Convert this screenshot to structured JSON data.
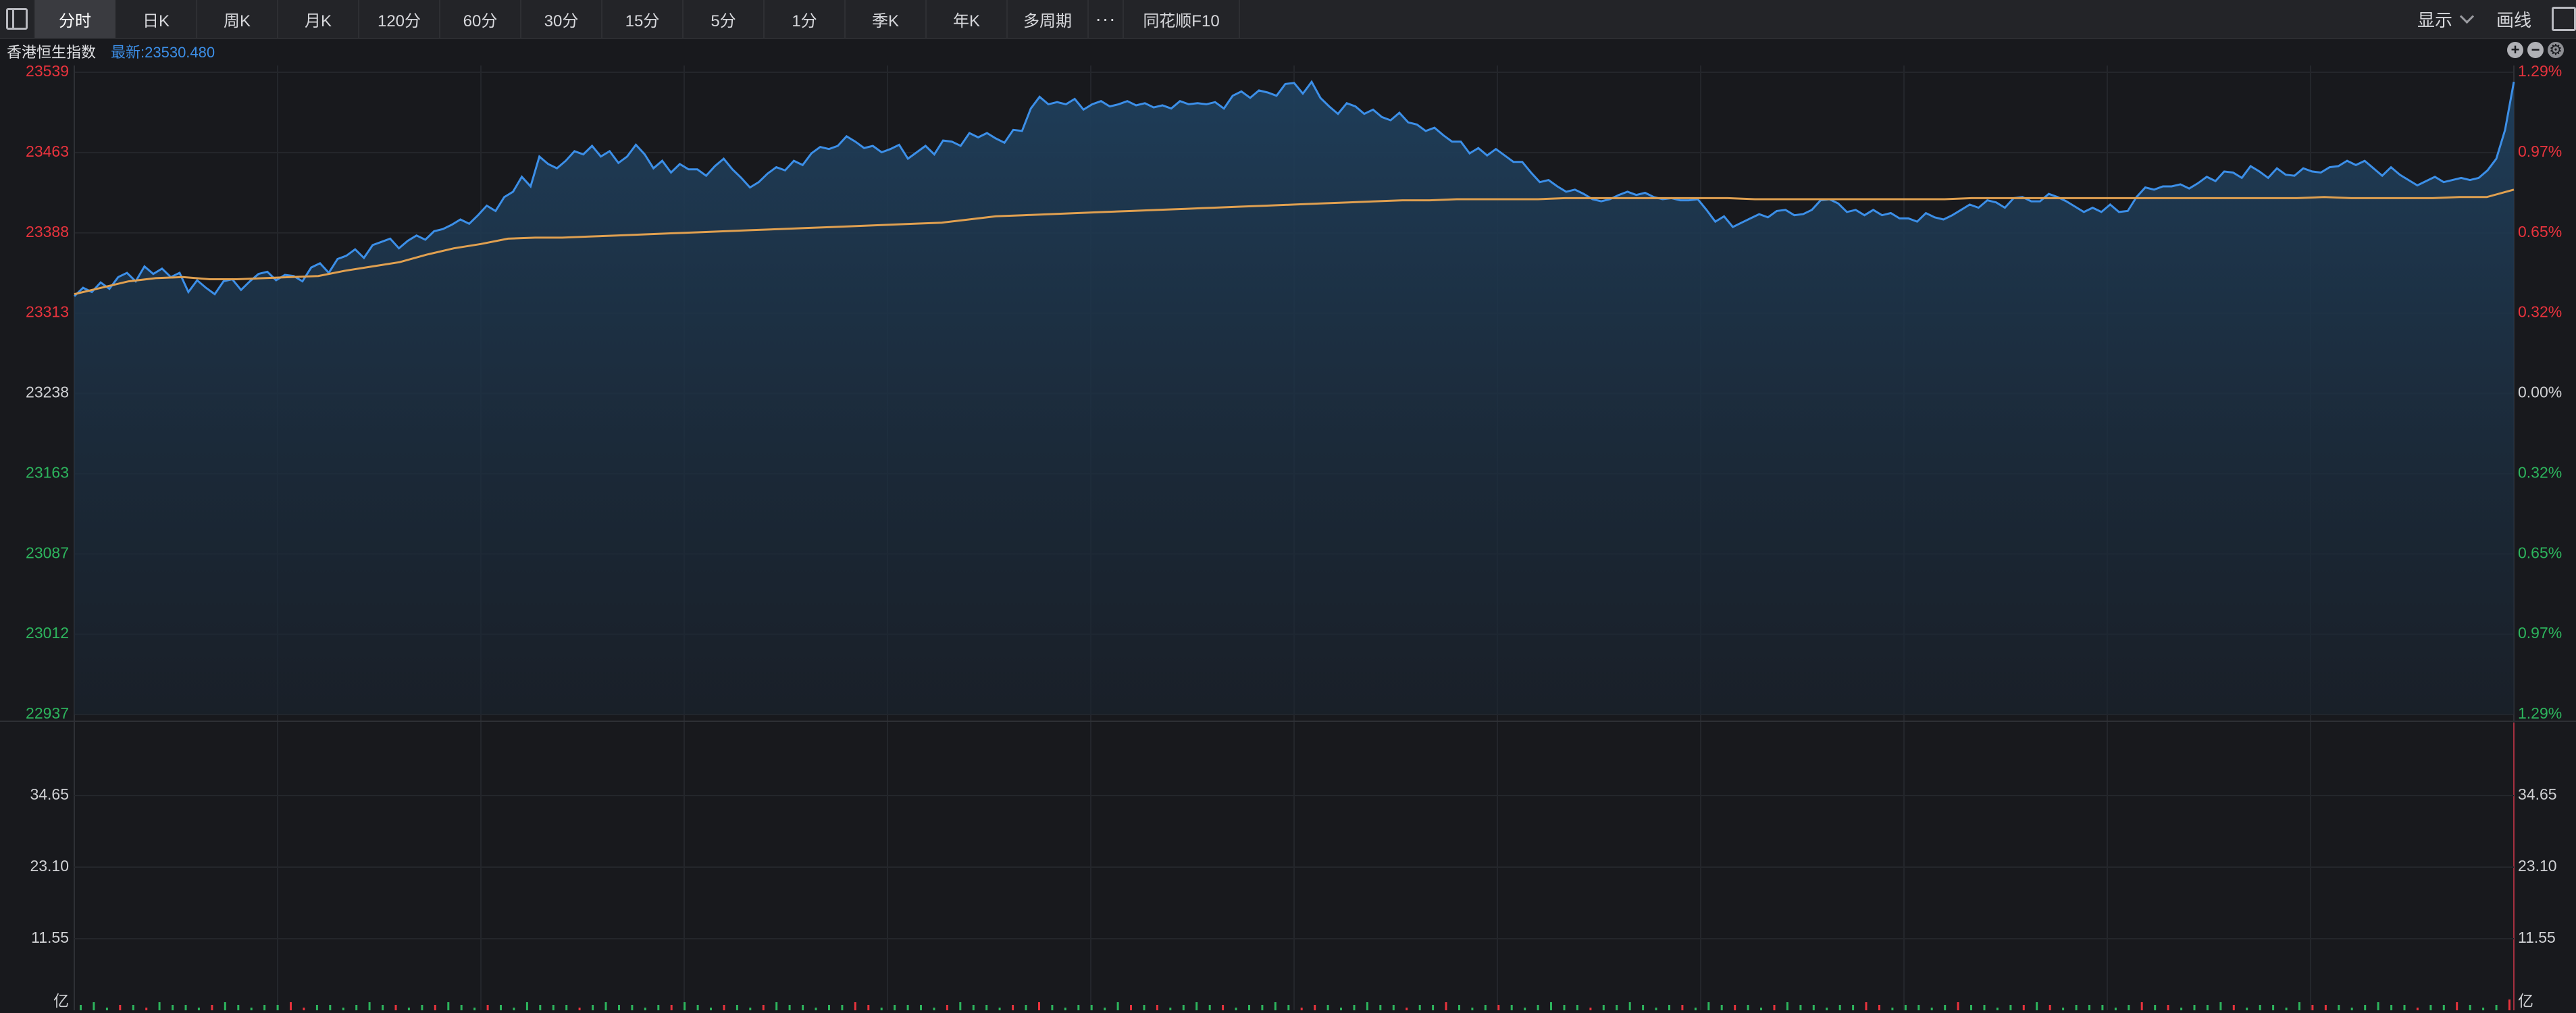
{
  "toolbar": {
    "tabs": [
      "分时",
      "日K",
      "周K",
      "月K",
      "120分",
      "60分",
      "30分",
      "15分",
      "5分",
      "1分",
      "季K",
      "年K",
      "多周期"
    ],
    "more": "···",
    "f10": "同花顺F10",
    "display": "显示",
    "draw": "画线"
  },
  "info": {
    "name": "香港恒生指数",
    "latest": "最新:23530.480"
  },
  "colors": {
    "up": "#e8333d",
    "down": "#2db55d",
    "neutral": "#d0d1d4",
    "price_line": "#3c8fe8",
    "avg_line": "#e0a050"
  },
  "chart_data": {
    "type": "line",
    "price_axis": {
      "ylim": [
        22937,
        23539
      ],
      "ticks": [
        "23539",
        "23463",
        "23388",
        "23313",
        "23238",
        "23163",
        "23087",
        "23012",
        "22937"
      ],
      "pct_ticks": [
        "1.29%",
        "0.97%",
        "0.65%",
        "0.32%",
        "0.00%",
        "0.32%",
        "0.65%",
        "0.97%",
        "1.29%"
      ]
    },
    "volume_axis": {
      "ticks": [
        "34.65",
        "23.10",
        "11.55"
      ],
      "unit": "亿"
    },
    "series": [
      {
        "values": [
          23329,
          23337,
          23333,
          23342,
          23336,
          23347,
          23351,
          23343,
          23357,
          23350,
          23355,
          23347,
          23351,
          23333,
          23344,
          23337,
          23331,
          23343,
          23345,
          23335,
          23343,
          23350,
          23352,
          23344,
          23349,
          23348,
          23343,
          23356,
          23360,
          23351,
          23364,
          23367,
          23373,
          23365,
          23377,
          23380,
          23383,
          23374,
          23381,
          23386,
          23382,
          23390,
          23392,
          23396,
          23401,
          23397,
          23405,
          23414,
          23409,
          23422,
          23427,
          23441,
          23432,
          23460,
          23453,
          23449,
          23456,
          23465,
          23462,
          23470,
          23460,
          23465,
          23454,
          23460,
          23471,
          23462,
          23449,
          23456,
          23445,
          23453,
          23448,
          23448,
          23442,
          23451,
          23458,
          23448,
          23440,
          23431,
          23436,
          23444,
          23450,
          23447,
          23456,
          23452,
          23463,
          23469,
          23467,
          23470,
          23479,
          23474,
          23468,
          23470,
          23464,
          23467,
          23471,
          23458,
          23464,
          23470,
          23462,
          23475,
          23474,
          23470,
          23482,
          23478,
          23482,
          23477,
          23473,
          23485,
          23484,
          23505,
          23516,
          23509,
          23511,
          23509,
          23514,
          23504,
          23509,
          23512,
          23507,
          23509,
          23512,
          23508,
          23510,
          23506,
          23508,
          23505,
          23512,
          23509,
          23510,
          23509,
          23511,
          23505,
          23517,
          23521,
          23515,
          23522,
          23520,
          23517,
          23528,
          23529,
          23519,
          23530,
          23515,
          23507,
          23500,
          23510,
          23507,
          23500,
          23504,
          23497,
          23494,
          23501,
          23492,
          23490,
          23484,
          23487,
          23480,
          23474,
          23474,
          23463,
          23468,
          23461,
          23467,
          23461,
          23455,
          23455,
          23445,
          23436,
          23438,
          23432,
          23427,
          23429,
          23425,
          23420,
          23418,
          23420,
          23424,
          23427,
          23424,
          23426,
          23422,
          23420,
          23421,
          23419,
          23419,
          23420,
          23410,
          23399,
          23404,
          23394,
          23398,
          23402,
          23406,
          23403,
          23409,
          23410,
          23405,
          23406,
          23410,
          23419,
          23420,
          23416,
          23408,
          23410,
          23405,
          23410,
          23405,
          23407,
          23402,
          23402,
          23399,
          23407,
          23403,
          23401,
          23405,
          23410,
          23415,
          23412,
          23419,
          23417,
          23412,
          23421,
          23422,
          23418,
          23418,
          23425,
          23422,
          23418,
          23413,
          23408,
          23412,
          23408,
          23415,
          23408,
          23409,
          23422,
          23431,
          23429,
          23432,
          23432,
          23434,
          23430,
          23435,
          23441,
          23437,
          23446,
          23445,
          23440,
          23451,
          23446,
          23440,
          23449,
          23443,
          23442,
          23449,
          23446,
          23445,
          23450,
          23451,
          23456,
          23452,
          23456,
          23449,
          23442,
          23450,
          23443,
          23438,
          23433,
          23437,
          23441,
          23436,
          23438,
          23440,
          23438,
          23440,
          23447,
          23458,
          23485,
          23530
        ],
        "color": "#3c8fe8"
      },
      {
        "values": [
          23331,
          23337,
          23343,
          23346,
          23347,
          23345,
          23345,
          23346,
          23347,
          23348,
          23353,
          23357,
          23361,
          23368,
          23374,
          23378,
          23383,
          23384,
          23384,
          23385,
          23386,
          23387,
          23388,
          23389,
          23390,
          23391,
          23392,
          23393,
          23394,
          23395,
          23396,
          23397,
          23398,
          23401,
          23404,
          23405,
          23406,
          23407,
          23408,
          23409,
          23410,
          23411,
          23412,
          23413,
          23414,
          23415,
          23416,
          23417,
          23418,
          23419,
          23419,
          23420,
          23420,
          23420,
          23420,
          23421,
          23421,
          23421,
          23421,
          23421,
          23421,
          23421,
          23420,
          23420,
          23420,
          23420,
          23420,
          23420,
          23420,
          23420,
          23421,
          23421,
          23421,
          23421,
          23421,
          23421,
          23421,
          23421,
          23421,
          23421,
          23421,
          23421,
          23421,
          23422,
          23421,
          23421,
          23421,
          23421,
          23422,
          23422,
          23429
        ],
        "color": "#e0a050"
      }
    ],
    "volume": [
      2,
      3,
      1,
      2,
      2,
      1,
      3,
      2,
      2,
      1,
      2,
      3,
      2,
      1,
      2,
      2,
      3,
      1,
      2,
      2,
      1,
      2,
      3,
      2,
      2,
      1,
      2,
      2,
      3,
      2,
      1,
      2,
      2,
      1,
      3,
      2,
      2,
      2,
      1,
      2,
      3,
      2,
      2,
      1,
      2,
      2,
      3,
      2,
      1,
      2,
      2,
      1,
      2,
      3,
      2,
      2,
      1,
      2,
      2,
      3,
      2,
      1,
      2,
      2,
      2,
      1,
      2,
      3,
      2,
      2,
      1,
      2,
      2,
      3,
      2,
      1,
      2,
      2,
      1,
      3,
      2,
      2,
      2,
      1,
      2,
      3,
      2,
      2,
      1,
      2,
      2,
      3,
      2,
      1,
      2,
      2,
      1,
      2,
      3,
      2,
      2,
      1,
      2,
      2,
      3,
      2,
      1,
      2,
      2,
      2,
      1,
      2,
      3,
      2,
      2,
      1,
      2,
      2,
      3,
      2,
      1,
      2,
      2,
      1,
      3,
      2,
      2,
      2,
      1,
      2,
      3,
      2,
      2,
      1,
      2,
      2,
      3,
      2,
      1,
      2,
      2,
      1,
      2,
      3,
      2,
      2,
      1,
      2,
      2,
      3,
      2,
      1,
      2,
      2,
      2,
      1,
      2,
      3,
      2,
      2,
      1,
      2,
      2,
      3,
      2,
      1,
      2,
      2,
      1,
      3,
      2,
      2,
      2,
      1,
      2,
      3,
      2,
      2,
      1,
      2,
      2,
      3,
      2,
      1,
      2,
      4
    ]
  }
}
